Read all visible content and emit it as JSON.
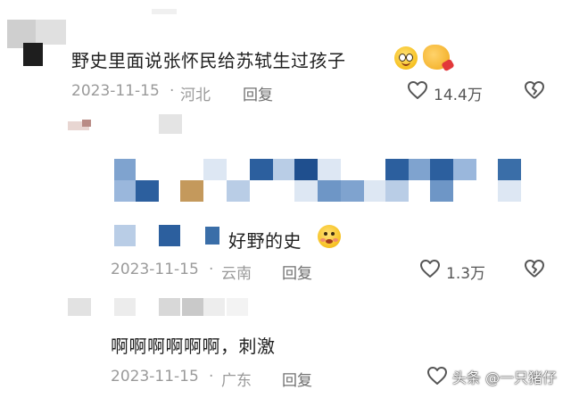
{
  "colors": {
    "mosaic_blue_dark": "#2c5f9e",
    "mosaic_blue_mid": "#6e96c6",
    "mosaic_blue_light": "#b9cde6",
    "mosaic_blue_pale": "#dde7f3",
    "mosaic_tan": "#c4995c",
    "mosaic_gray_light": "#e6e6e6",
    "mosaic_gray_dark": "#3a3a3a",
    "icon_gray": "#555555"
  },
  "comments": [
    {
      "text": "野史里面说张怀民给苏轼生过孩子",
      "emojis": [
        "smile-emoji",
        "hand-emoji"
      ],
      "date": "2023-11-15",
      "separator": "·",
      "location": "河北",
      "reply_label": "回复",
      "like_count": "14.4万"
    },
    {
      "text": "好野的史",
      "emojis": [
        "worried-emoji"
      ],
      "date": "2023-11-15",
      "separator": "·",
      "location": "云南",
      "reply_label": "回复",
      "like_count": "1.3万"
    },
    {
      "text": "啊啊啊啊啊啊，刺激",
      "date": "2023-11-15",
      "separator": "·",
      "location": "广东",
      "reply_label": "回复"
    }
  ],
  "watermark": {
    "prefix": "头条",
    "handle": "@一只猪仔"
  }
}
